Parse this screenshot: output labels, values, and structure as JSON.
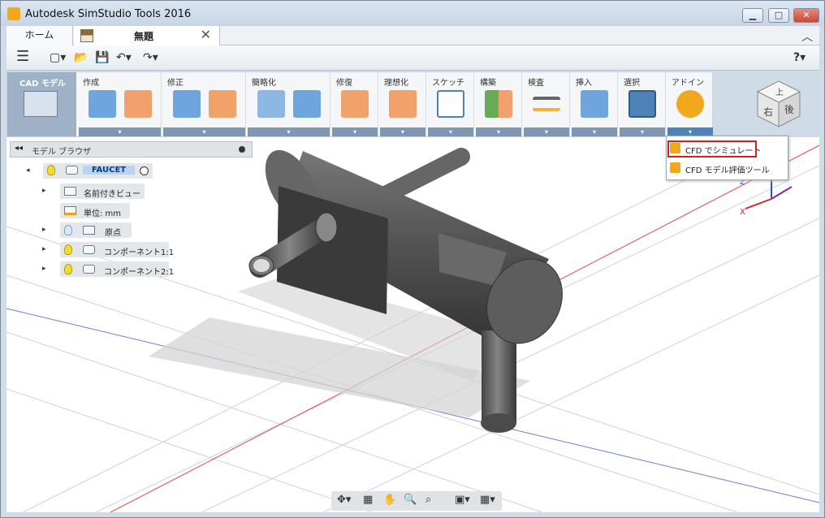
{
  "window": {
    "title": "Autodesk SimStudio Tools 2016",
    "minimize": "▁",
    "maximize": "□",
    "close": "✕"
  },
  "tabs": {
    "home": "ホーム",
    "document": "無題",
    "close": "✕",
    "collapse": "︿"
  },
  "quick_access": {
    "menu": "☰",
    "new": "▢▾",
    "open": "📂",
    "save": "💾",
    "undo": "↶▾",
    "redo": "↷▾",
    "help": "?▾"
  },
  "ribbon": {
    "mode": "CAD モデル",
    "sections": [
      {
        "label": "作成"
      },
      {
        "label": "修正"
      },
      {
        "label": "簡略化"
      },
      {
        "label": "修復"
      },
      {
        "label": "理想化"
      },
      {
        "label": "スケッチ"
      },
      {
        "label": "構築"
      },
      {
        "label": "検査"
      },
      {
        "label": "挿入"
      },
      {
        "label": "選択"
      },
      {
        "label": "アドイン"
      }
    ],
    "dropdown_marker": "▾"
  },
  "addin_menu": {
    "items": [
      {
        "label": "CFD でシミュレート"
      },
      {
        "label": "CFD モデル評価ツール"
      }
    ]
  },
  "browser": {
    "title": "モデル ブラウザ",
    "collapse": "◂◂",
    "root": "FAUCET",
    "items": [
      {
        "label": "名前付きビュー"
      },
      {
        "label": "単位: mm"
      },
      {
        "label": "原点"
      },
      {
        "label": "コンポーネント1:1"
      },
      {
        "label": "コンポーネント2:1"
      }
    ],
    "tree_toggle": "▸",
    "root_toggle": "◂"
  },
  "viewcube": {
    "top": "上",
    "right": "右",
    "back": "後"
  },
  "axis_labels": {
    "x": "X",
    "z": "Z"
  },
  "navigation": {
    "orbit": "✥▾",
    "look": "▦",
    "pan": "✋",
    "zoom": "🔍",
    "fit": "⌕",
    "display": "▣▾",
    "grid": "▦▾"
  },
  "colors": {
    "accent": "#7f97b3",
    "highlight": "#d21f22",
    "addin": "#f2a81c",
    "selected_tool": "#4d83b7"
  }
}
